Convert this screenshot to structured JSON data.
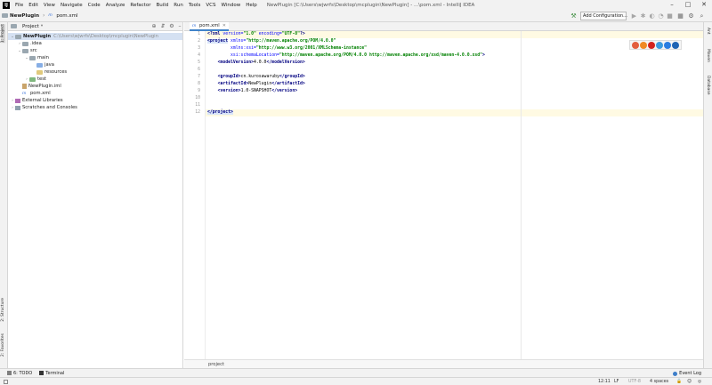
{
  "menu": {
    "logo": "IJ",
    "items": [
      "File",
      "Edit",
      "View",
      "Navigate",
      "Code",
      "Analyze",
      "Refactor",
      "Build",
      "Run",
      "Tools",
      "VCS",
      "Window",
      "Help"
    ],
    "window_title": "NewPlugin [C:\\Users\\wjwrfs\\Desktop\\mcplugin\\NewPlugin] - ...\\pom.xml - IntelliJ IDEA"
  },
  "navbar": {
    "project": "NewPlugin",
    "file": "pom.xml",
    "add_configuration": "Add Configuration..."
  },
  "left_strip": {
    "project_tab": "1: Project",
    "structure_tab": "2: Structure",
    "favorites_tab": "2: Favorites"
  },
  "right_strip": {
    "ant_tab": "Ant",
    "maven_tab": "Maven",
    "database_tab": "Database"
  },
  "project_panel": {
    "title": "Project",
    "tree": [
      {
        "label": "NewPlugin",
        "path": "C:\\Users\\wjwrfs\\Desktop\\mcplugin\\NewPlugin",
        "depth": 0,
        "expanded": true,
        "icon": "folder"
      },
      {
        "label": ".idea",
        "depth": 1,
        "expanded": false,
        "icon": "folder"
      },
      {
        "label": "src",
        "depth": 1,
        "expanded": true,
        "icon": "folder"
      },
      {
        "label": "main",
        "depth": 2,
        "expanded": true,
        "icon": "folder"
      },
      {
        "label": "java",
        "depth": 3,
        "icon": "folder-blue"
      },
      {
        "label": "resources",
        "depth": 3,
        "icon": "folder-yellow"
      },
      {
        "label": "test",
        "depth": 2,
        "expanded": false,
        "icon": "folder-green"
      },
      {
        "label": "NewPlugin.iml",
        "depth": 1,
        "icon": "iml-file"
      },
      {
        "label": "pom.xml",
        "depth": 1,
        "icon": "maven-file"
      },
      {
        "label": "External Libraries",
        "depth": 0,
        "expanded": false,
        "icon": "library"
      },
      {
        "label": "Scratches and Consoles",
        "depth": 0,
        "expanded": false,
        "icon": "scratches"
      }
    ]
  },
  "editor": {
    "tab": "pom.xml",
    "line_numbers": [
      "1",
      "2",
      "3",
      "4",
      "5",
      "6",
      "7",
      "8",
      "9",
      "10",
      "11",
      "12"
    ],
    "lines": [
      {
        "parts": [
          [
            "tag",
            "<?xml "
          ],
          [
            "attr",
            "version="
          ],
          [
            "val",
            "\"1.0\" "
          ],
          [
            "attr",
            "encoding="
          ],
          [
            "val",
            "\"UTF-8\""
          ],
          [
            "tag",
            "?>"
          ]
        ]
      },
      {
        "parts": [
          [
            "tag tagbg",
            "<project"
          ],
          [
            "attr",
            " xmlns="
          ],
          [
            "val",
            "\"http://maven.apache.org/POM/4.0.0\""
          ]
        ]
      },
      {
        "parts": [
          [
            "txt",
            "         "
          ],
          [
            "attr",
            "xmlns:xsi="
          ],
          [
            "val",
            "\"http://www.w3.org/2001/XMLSchema-instance\""
          ]
        ]
      },
      {
        "parts": [
          [
            "txt",
            "         "
          ],
          [
            "attr",
            "xsi:schemaLocation="
          ],
          [
            "val",
            "\"http://maven.apache.org/POM/4.0.0 http://maven.apache.org/xsd/maven-4.0.0.xsd\""
          ],
          [
            "tag",
            ">"
          ]
        ]
      },
      {
        "parts": [
          [
            "txt",
            "    "
          ],
          [
            "tag",
            "<modelVersion>"
          ],
          [
            "txt",
            "4.0.0"
          ],
          [
            "tag",
            "</modelVersion>"
          ]
        ]
      },
      {
        "parts": []
      },
      {
        "parts": [
          [
            "txt",
            "    "
          ],
          [
            "tag",
            "<groupId>"
          ],
          [
            "txt",
            "cn.kurosawaruby"
          ],
          [
            "tag",
            "</groupId>"
          ]
        ]
      },
      {
        "parts": [
          [
            "txt",
            "    "
          ],
          [
            "tag",
            "<artifactId>"
          ],
          [
            "txt",
            "NewPlugin"
          ],
          [
            "tag",
            "</artifactId>"
          ]
        ]
      },
      {
        "parts": [
          [
            "txt",
            "    "
          ],
          [
            "tag",
            "<version>"
          ],
          [
            "txt",
            "1.0-SNAPSHOT"
          ],
          [
            "tag",
            "</version>"
          ]
        ]
      },
      {
        "parts": []
      },
      {
        "parts": []
      },
      {
        "parts": [
          [
            "tag tagbg",
            "</project>"
          ]
        ]
      }
    ],
    "breadcrumb": "project"
  },
  "bottom_toolbar": {
    "todo": "6: TODO",
    "terminal": "Terminal",
    "event_log": "Event Log"
  },
  "status": {
    "position": "12:11",
    "line_sep": "LF",
    "encoding": "UTF-8",
    "indent": "4 spaces"
  },
  "colors": {
    "tag": "#000080",
    "attr": "#0000ff",
    "value": "#008000",
    "caret_line": "#fffae3",
    "tag_highlight": "#d8e4f8"
  }
}
